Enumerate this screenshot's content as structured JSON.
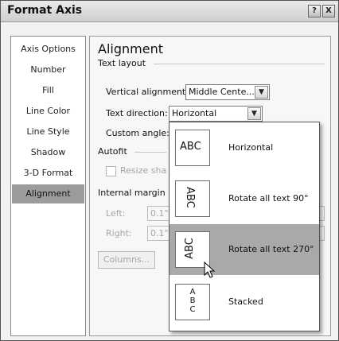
{
  "window": {
    "title": "Format Axis",
    "help_icon": "?",
    "close_icon": "X"
  },
  "sidebar": {
    "items": [
      {
        "label": "Axis Options"
      },
      {
        "label": "Number"
      },
      {
        "label": "Fill"
      },
      {
        "label": "Line Color"
      },
      {
        "label": "Line Style"
      },
      {
        "label": "Shadow"
      },
      {
        "label": "3-D Format"
      },
      {
        "label": "Alignment",
        "selected": true
      }
    ]
  },
  "panel": {
    "heading": "Alignment",
    "text_layout": {
      "group_label": "Text layout",
      "vertical_alignment_label": "Vertical alignment:",
      "vertical_alignment_value": "Middle Cente...",
      "text_direction_label": "Text direction:",
      "text_direction_value": "Horizontal",
      "custom_angle_label": "Custom angle:"
    },
    "autofit": {
      "group_label": "Autofit",
      "resize_label": "Resize sha"
    },
    "internal_margin": {
      "group_label": "Internal margin",
      "left_label": "Left:",
      "left_value": "0.1\"",
      "right_label": "Right:",
      "right_value": "0.1\"",
      "columns_button": "Columns..."
    }
  },
  "dropdown": {
    "options": [
      {
        "preview": "ABC",
        "label": "Horizontal"
      },
      {
        "preview": "ABC",
        "label": "Rotate all text 90°"
      },
      {
        "preview": "ABC",
        "label": "Rotate all text 270°",
        "highlighted": true
      },
      {
        "preview_stack": [
          "A",
          "B",
          "C"
        ],
        "label": "Stacked"
      }
    ]
  },
  "colors": {
    "selection_gray": "#9c9c9c",
    "highlight_gray": "#a9a9a9"
  }
}
